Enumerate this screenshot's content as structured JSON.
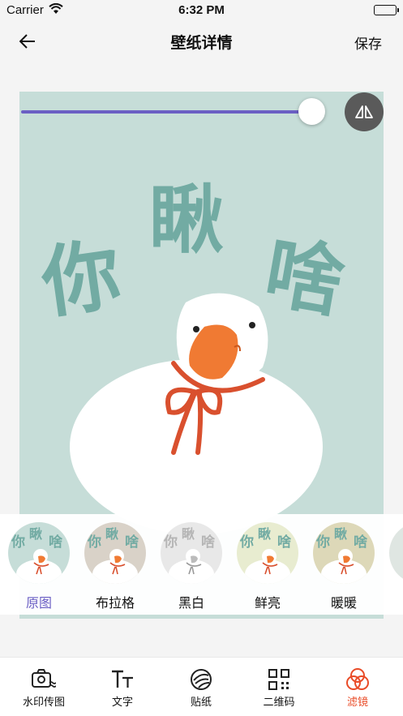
{
  "status_bar": {
    "carrier": "Carrier",
    "time": "6:32 PM"
  },
  "nav": {
    "title": "壁纸详情",
    "save_label": "保存"
  },
  "artwork": {
    "headline": [
      "你",
      "瞅",
      "啥"
    ]
  },
  "filters": [
    {
      "label": "原图",
      "active": true,
      "tint": "#c6ddd8"
    },
    {
      "label": "布拉格",
      "active": false,
      "tint": "#d9d2c8"
    },
    {
      "label": "黑白",
      "active": false,
      "tint": "#e8e8e8"
    },
    {
      "label": "鲜亮",
      "active": false,
      "tint": "#e8ecd0"
    },
    {
      "label": "暖暖",
      "active": false,
      "tint": "#ddd8b8"
    }
  ],
  "tabs": [
    {
      "label": "水印传图",
      "icon": "camera-watermark-icon",
      "active": false
    },
    {
      "label": "文字",
      "icon": "text-icon",
      "active": false
    },
    {
      "label": "贴纸",
      "icon": "sticker-icon",
      "active": false
    },
    {
      "label": "二维码",
      "icon": "qr-code-icon",
      "active": false
    },
    {
      "label": "滤镜",
      "icon": "filter-icon",
      "active": true
    }
  ],
  "colors": {
    "accent": "#6b5fc4",
    "active_tab": "#e94b27",
    "background": "#c6ddd8"
  }
}
